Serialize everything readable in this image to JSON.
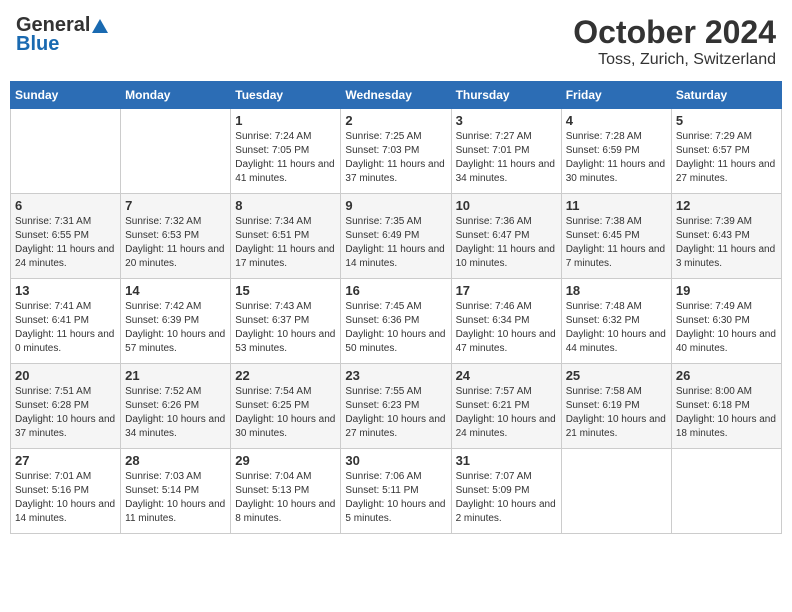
{
  "header": {
    "logo_general": "General",
    "logo_blue": "Blue",
    "month": "October 2024",
    "location": "Toss, Zurich, Switzerland"
  },
  "weekdays": [
    "Sunday",
    "Monday",
    "Tuesday",
    "Wednesday",
    "Thursday",
    "Friday",
    "Saturday"
  ],
  "weeks": [
    [
      {
        "day": "",
        "content": ""
      },
      {
        "day": "",
        "content": ""
      },
      {
        "day": "1",
        "content": "Sunrise: 7:24 AM\nSunset: 7:05 PM\nDaylight: 11 hours and 41 minutes."
      },
      {
        "day": "2",
        "content": "Sunrise: 7:25 AM\nSunset: 7:03 PM\nDaylight: 11 hours and 37 minutes."
      },
      {
        "day": "3",
        "content": "Sunrise: 7:27 AM\nSunset: 7:01 PM\nDaylight: 11 hours and 34 minutes."
      },
      {
        "day": "4",
        "content": "Sunrise: 7:28 AM\nSunset: 6:59 PM\nDaylight: 11 hours and 30 minutes."
      },
      {
        "day": "5",
        "content": "Sunrise: 7:29 AM\nSunset: 6:57 PM\nDaylight: 11 hours and 27 minutes."
      }
    ],
    [
      {
        "day": "6",
        "content": "Sunrise: 7:31 AM\nSunset: 6:55 PM\nDaylight: 11 hours and 24 minutes."
      },
      {
        "day": "7",
        "content": "Sunrise: 7:32 AM\nSunset: 6:53 PM\nDaylight: 11 hours and 20 minutes."
      },
      {
        "day": "8",
        "content": "Sunrise: 7:34 AM\nSunset: 6:51 PM\nDaylight: 11 hours and 17 minutes."
      },
      {
        "day": "9",
        "content": "Sunrise: 7:35 AM\nSunset: 6:49 PM\nDaylight: 11 hours and 14 minutes."
      },
      {
        "day": "10",
        "content": "Sunrise: 7:36 AM\nSunset: 6:47 PM\nDaylight: 11 hours and 10 minutes."
      },
      {
        "day": "11",
        "content": "Sunrise: 7:38 AM\nSunset: 6:45 PM\nDaylight: 11 hours and 7 minutes."
      },
      {
        "day": "12",
        "content": "Sunrise: 7:39 AM\nSunset: 6:43 PM\nDaylight: 11 hours and 3 minutes."
      }
    ],
    [
      {
        "day": "13",
        "content": "Sunrise: 7:41 AM\nSunset: 6:41 PM\nDaylight: 11 hours and 0 minutes."
      },
      {
        "day": "14",
        "content": "Sunrise: 7:42 AM\nSunset: 6:39 PM\nDaylight: 10 hours and 57 minutes."
      },
      {
        "day": "15",
        "content": "Sunrise: 7:43 AM\nSunset: 6:37 PM\nDaylight: 10 hours and 53 minutes."
      },
      {
        "day": "16",
        "content": "Sunrise: 7:45 AM\nSunset: 6:36 PM\nDaylight: 10 hours and 50 minutes."
      },
      {
        "day": "17",
        "content": "Sunrise: 7:46 AM\nSunset: 6:34 PM\nDaylight: 10 hours and 47 minutes."
      },
      {
        "day": "18",
        "content": "Sunrise: 7:48 AM\nSunset: 6:32 PM\nDaylight: 10 hours and 44 minutes."
      },
      {
        "day": "19",
        "content": "Sunrise: 7:49 AM\nSunset: 6:30 PM\nDaylight: 10 hours and 40 minutes."
      }
    ],
    [
      {
        "day": "20",
        "content": "Sunrise: 7:51 AM\nSunset: 6:28 PM\nDaylight: 10 hours and 37 minutes."
      },
      {
        "day": "21",
        "content": "Sunrise: 7:52 AM\nSunset: 6:26 PM\nDaylight: 10 hours and 34 minutes."
      },
      {
        "day": "22",
        "content": "Sunrise: 7:54 AM\nSunset: 6:25 PM\nDaylight: 10 hours and 30 minutes."
      },
      {
        "day": "23",
        "content": "Sunrise: 7:55 AM\nSunset: 6:23 PM\nDaylight: 10 hours and 27 minutes."
      },
      {
        "day": "24",
        "content": "Sunrise: 7:57 AM\nSunset: 6:21 PM\nDaylight: 10 hours and 24 minutes."
      },
      {
        "day": "25",
        "content": "Sunrise: 7:58 AM\nSunset: 6:19 PM\nDaylight: 10 hours and 21 minutes."
      },
      {
        "day": "26",
        "content": "Sunrise: 8:00 AM\nSunset: 6:18 PM\nDaylight: 10 hours and 18 minutes."
      }
    ],
    [
      {
        "day": "27",
        "content": "Sunrise: 7:01 AM\nSunset: 5:16 PM\nDaylight: 10 hours and 14 minutes."
      },
      {
        "day": "28",
        "content": "Sunrise: 7:03 AM\nSunset: 5:14 PM\nDaylight: 10 hours and 11 minutes."
      },
      {
        "day": "29",
        "content": "Sunrise: 7:04 AM\nSunset: 5:13 PM\nDaylight: 10 hours and 8 minutes."
      },
      {
        "day": "30",
        "content": "Sunrise: 7:06 AM\nSunset: 5:11 PM\nDaylight: 10 hours and 5 minutes."
      },
      {
        "day": "31",
        "content": "Sunrise: 7:07 AM\nSunset: 5:09 PM\nDaylight: 10 hours and 2 minutes."
      },
      {
        "day": "",
        "content": ""
      },
      {
        "day": "",
        "content": ""
      }
    ]
  ]
}
